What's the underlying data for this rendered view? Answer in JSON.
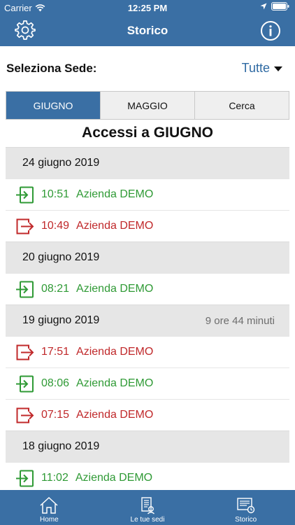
{
  "status": {
    "carrier": "Carrier",
    "time": "12:25 PM"
  },
  "header": {
    "title": "Storico",
    "settings_icon": "gear-icon",
    "info_icon": "info-icon"
  },
  "sede": {
    "label": "Seleziona Sede:",
    "value": "Tutte"
  },
  "tabs": [
    {
      "label": "GIUGNO",
      "active": true
    },
    {
      "label": "MAGGIO",
      "active": false
    },
    {
      "label": "Cerca",
      "active": false
    }
  ],
  "heading": "Accessi a GIUGNO",
  "colors": {
    "primary": "#3a6fa4",
    "entry_in": "#2f9a35",
    "entry_out": "#c0282a",
    "section_bg": "#e6e6e6"
  },
  "days": [
    {
      "date": "24 giugno 2019",
      "duration": "",
      "entries": [
        {
          "time": "10:51",
          "place": "Azienda DEMO",
          "type": "in"
        },
        {
          "time": "10:49",
          "place": "Azienda DEMO",
          "type": "out"
        }
      ]
    },
    {
      "date": "20 giugno 2019",
      "duration": "",
      "entries": [
        {
          "time": "08:21",
          "place": "Azienda DEMO",
          "type": "in"
        }
      ]
    },
    {
      "date": "19 giugno 2019",
      "duration": "9 ore 44 minuti",
      "entries": [
        {
          "time": "17:51",
          "place": "Azienda DEMO",
          "type": "out"
        },
        {
          "time": "08:06",
          "place": "Azienda DEMO",
          "type": "in"
        },
        {
          "time": "07:15",
          "place": "Azienda DEMO",
          "type": "out"
        }
      ]
    },
    {
      "date": "18 giugno 2019",
      "duration": "",
      "entries": [
        {
          "time": "11:02",
          "place": "Azienda DEMO",
          "type": "in"
        }
      ]
    }
  ],
  "tabbar": [
    {
      "label": "Home",
      "icon": "home-icon"
    },
    {
      "label": "Le tue sedi",
      "icon": "locations-icon"
    },
    {
      "label": "Storico",
      "icon": "history-icon"
    }
  ]
}
